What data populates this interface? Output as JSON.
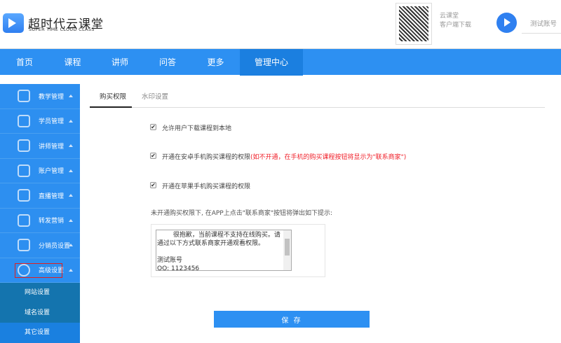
{
  "brand": {
    "name": "超时代云课堂",
    "subtitle": "SUPER TIME CLOUD CLASS"
  },
  "header": {
    "qr_line1": "云课堂",
    "qr_line2": "客户端下载",
    "account": "测试账号"
  },
  "nav": [
    "首页",
    "课程",
    "讲师",
    "问答",
    "更多",
    "管理中心"
  ],
  "sidebar": {
    "items": [
      {
        "label": "教学管理",
        "icon": "teaching-icon"
      },
      {
        "label": "学员管理",
        "icon": "student-icon"
      },
      {
        "label": "讲师管理",
        "icon": "lecturer-icon"
      },
      {
        "label": "账户管理",
        "icon": "account-icon"
      },
      {
        "label": "直播管理",
        "icon": "live-icon"
      },
      {
        "label": "转发营销",
        "icon": "share-icon"
      },
      {
        "label": "分销员设置",
        "icon": "distributor-icon"
      },
      {
        "label": "高级设置",
        "icon": "gear-icon"
      }
    ],
    "sub": [
      "网站设置",
      "域名设置",
      "其它设置"
    ]
  },
  "tabs": [
    "购买权限",
    "水印设置"
  ],
  "options": [
    {
      "label": "允许用户下载课程到本地",
      "checked": true
    },
    {
      "label": "开通在安卓手机购买课程的权限",
      "note": "(如不开通，在手机的购买课程按钮将显示为\"联系商家\")",
      "checked": true
    },
    {
      "label": "开通在苹果手机购买课程的权限",
      "checked": true
    }
  ],
  "hint": "未开通购买权限下, 在APP上点击\"联系商家\"按钮将弹出如下提示:",
  "message": {
    "line1": "        很抱歉，当前课程不支持在线购买。请通过以下方式联系商家开通观看权限。",
    "line2": "测试账号",
    "line3": "QQ: 1123456"
  },
  "save": "保 存"
}
